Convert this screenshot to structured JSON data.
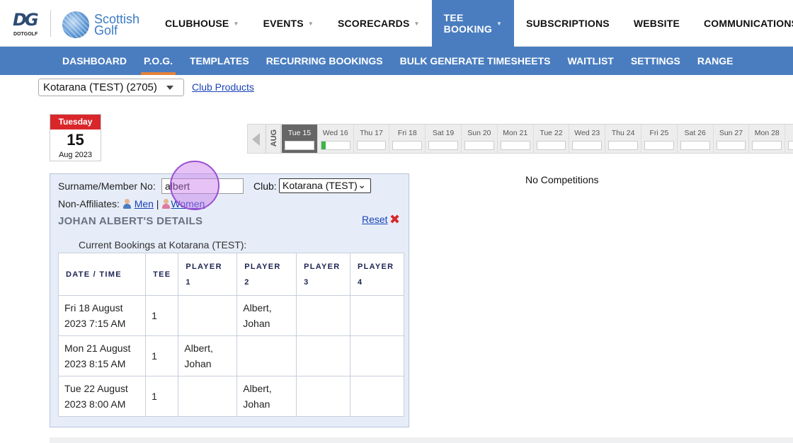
{
  "brand": {
    "dg_mark": "DG",
    "dg_text": "DOTGOLF",
    "sg_line1": "Scottish",
    "sg_line2": "Golf"
  },
  "topnav": [
    {
      "label": "CLUBHOUSE",
      "caret": true,
      "active": false
    },
    {
      "label": "EVENTS",
      "caret": true,
      "active": false
    },
    {
      "label": "SCORECARDS",
      "caret": true,
      "active": false
    },
    {
      "label": "TEE BOOKING",
      "caret": true,
      "active": true
    },
    {
      "label": "SUBSCRIPTIONS",
      "caret": false,
      "active": false
    },
    {
      "label": "WEBSITE",
      "caret": false,
      "active": false
    },
    {
      "label": "COMMUNICATIONS",
      "caret": true,
      "active": false
    }
  ],
  "subnav": [
    {
      "label": "DASHBOARD",
      "active": false
    },
    {
      "label": "P.O.G.",
      "active": true
    },
    {
      "label": "TEMPLATES",
      "active": false
    },
    {
      "label": "RECURRING BOOKINGS",
      "active": false
    },
    {
      "label": "BULK GENERATE TIMESHEETS",
      "active": false
    },
    {
      "label": "WAITLIST",
      "active": false
    },
    {
      "label": "SETTINGS",
      "active": false
    },
    {
      "label": "RANGE",
      "active": false
    }
  ],
  "club_select": {
    "value": "Kotarana (TEST) (2705)"
  },
  "club_products": "Club Products",
  "datecard": {
    "dow": "Tuesday",
    "day": "15",
    "month_year": "Aug 2023"
  },
  "strip": {
    "month": "AUG",
    "days": [
      {
        "label": "Tue 15",
        "selected": true,
        "fill": 0
      },
      {
        "label": "Wed 16",
        "selected": false,
        "fill": 0.15
      },
      {
        "label": "Thu 17",
        "selected": false,
        "fill": 0
      },
      {
        "label": "Fri 18",
        "selected": false,
        "fill": 0
      },
      {
        "label": "Sat 19",
        "selected": false,
        "fill": 0
      },
      {
        "label": "Sun 20",
        "selected": false,
        "fill": 0
      },
      {
        "label": "Mon 21",
        "selected": false,
        "fill": 0
      },
      {
        "label": "Tue 22",
        "selected": false,
        "fill": 0
      },
      {
        "label": "Wed 23",
        "selected": false,
        "fill": 0
      },
      {
        "label": "Thu 24",
        "selected": false,
        "fill": 0
      },
      {
        "label": "Fri 25",
        "selected": false,
        "fill": 0
      },
      {
        "label": "Sat 26",
        "selected": false,
        "fill": 0
      },
      {
        "label": "Sun 27",
        "selected": false,
        "fill": 0
      },
      {
        "label": "Mon 28",
        "selected": false,
        "fill": 0
      },
      {
        "label": "Tu",
        "selected": false,
        "fill": 0
      }
    ]
  },
  "no_competitions": "No Competitions",
  "panel": {
    "surname_label": "Surname/Member No:",
    "search_value": "albert",
    "club_label": "Club:",
    "club_value": "Kotarana (TEST)",
    "nonaff_label": "Non-Affiliates:",
    "men": "Men",
    "women": "Women",
    "details_title": "JOHAN ALBERT'S DETAILS",
    "reset": "Reset",
    "current_bookings": "Current Bookings at Kotarana (TEST):",
    "table": {
      "headers": [
        "DATE / TIME",
        "TEE",
        "PLAYER 1",
        "PLAYER 2",
        "PLAYER 3",
        "PLAYER 4"
      ],
      "rows": [
        [
          "Fri 18 August 2023 7:15 AM",
          "1",
          "",
          "Albert, Johan",
          "",
          ""
        ],
        [
          "Mon 21 August 2023 8:15 AM",
          "1",
          "Albert, Johan",
          "",
          "",
          ""
        ],
        [
          "Tue 22 August 2023 8:00 AM",
          "1",
          "",
          "Albert, Johan",
          "",
          ""
        ]
      ]
    }
  },
  "colors": {
    "primary": "#4a7dc0",
    "accent": "#e3833a",
    "date_red": "#d9262b",
    "avail_green": "#3bb54a"
  }
}
